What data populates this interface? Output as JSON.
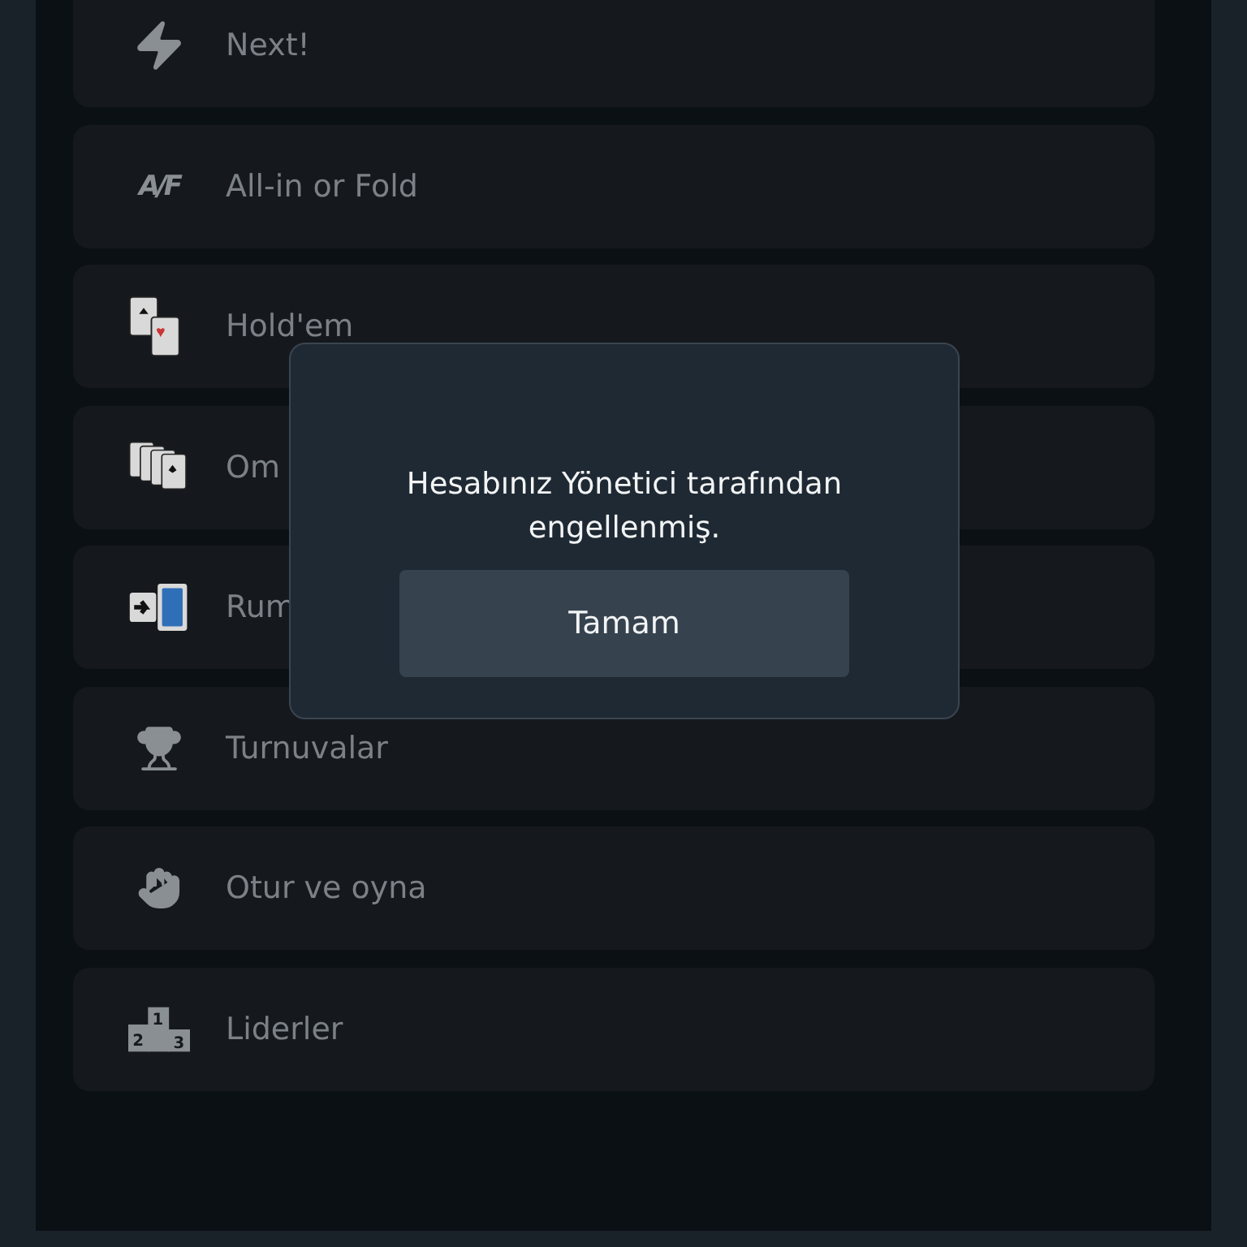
{
  "menu": [
    {
      "kind": "bolt",
      "label": "Next!"
    },
    {
      "kind": "af",
      "label": "All-in or Fold",
      "icon_text": "A/F"
    },
    {
      "kind": "cards2",
      "label": "Hold'em"
    },
    {
      "kind": "cards4",
      "label": "Om"
    },
    {
      "kind": "swap",
      "label": "Rum"
    },
    {
      "kind": "trophy",
      "label": "Turnuvalar"
    },
    {
      "kind": "hand",
      "label": "Otur ve oyna"
    },
    {
      "kind": "podium",
      "label": "Liderler",
      "places": [
        "2",
        "1",
        "3"
      ]
    }
  ],
  "dialog": {
    "message": "Hesabınız Yönetici tarafından engellenmiş.",
    "button": "Tamam"
  }
}
